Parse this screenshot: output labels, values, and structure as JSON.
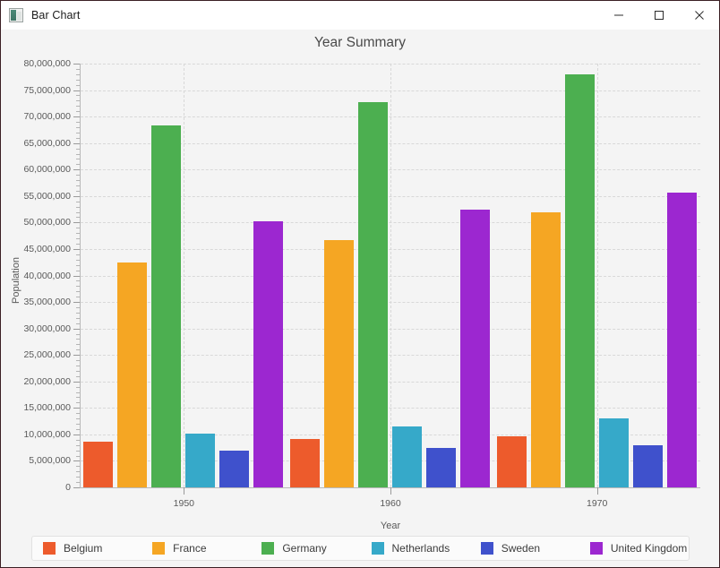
{
  "window": {
    "title": "Bar Chart",
    "icon": "bar-chart-app-icon",
    "controls": {
      "minimize": "Minimize",
      "maximize": "Maximize",
      "close": "Close"
    }
  },
  "chart_data": {
    "type": "bar",
    "title": "Year Summary",
    "xlabel": "Year",
    "ylabel": "Population",
    "categories": [
      "1950",
      "1960",
      "1970"
    ],
    "ylim": [
      0,
      80000000
    ],
    "ytick_step": 5000000,
    "yticks": [
      "0",
      "5,000,000",
      "10,000,000",
      "15,000,000",
      "20,000,000",
      "25,000,000",
      "30,000,000",
      "35,000,000",
      "40,000,000",
      "45,000,000",
      "50,000,000",
      "55,000,000",
      "60,000,000",
      "65,000,000",
      "70,000,000",
      "75,000,000",
      "80,000,000"
    ],
    "grid": true,
    "legend_position": "bottom",
    "series": [
      {
        "name": "Belgium",
        "color": "#ed5b2c",
        "values": [
          8700000,
          9200000,
          9700000
        ]
      },
      {
        "name": "France",
        "color": "#f5a623",
        "values": [
          42500000,
          46600000,
          51900000
        ]
      },
      {
        "name": "Germany",
        "color": "#4caf50",
        "values": [
          68300000,
          72700000,
          78000000
        ]
      },
      {
        "name": "Netherlands",
        "color": "#36a9c9",
        "values": [
          10200000,
          11500000,
          13000000
        ]
      },
      {
        "name": "Sweden",
        "color": "#3f51cc",
        "values": [
          7000000,
          7500000,
          8000000
        ]
      },
      {
        "name": "United Kingdom",
        "color": "#9c27d0",
        "values": [
          50200000,
          52400000,
          55600000
        ]
      }
    ]
  }
}
